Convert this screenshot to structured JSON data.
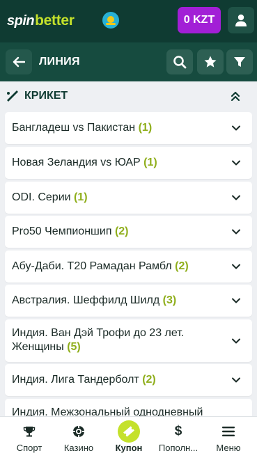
{
  "header": {
    "logo_left": "spin",
    "logo_right": "better",
    "balance": "0 KZT"
  },
  "subheader": {
    "title": "ЛИНИЯ"
  },
  "section": {
    "title": "КРИКЕТ"
  },
  "leagues": [
    {
      "name": "Бангладеш vs Пакистан",
      "count": "(1)"
    },
    {
      "name": "Новая Зеландия vs ЮАР",
      "count": "(1)"
    },
    {
      "name": "ODI. Серии",
      "count": "(1)"
    },
    {
      "name": "Pro50 Чемпионшип",
      "count": "(2)"
    },
    {
      "name": "Абу-Даби. T20 Рамадан Рамбл",
      "count": "(2)"
    },
    {
      "name": "Австралия. Шеффилд Шилд",
      "count": "(3)"
    },
    {
      "name": "Индия. Ван Дэй Трофи до 23 лет. Женщины",
      "count": "(5)"
    },
    {
      "name": "Индия. Лига Тандерболт",
      "count": "(2)"
    },
    {
      "name": "Индия. Межзональный однодневный",
      "count": ""
    }
  ],
  "bottom_nav": [
    {
      "label": "Спорт",
      "icon": "trophy-icon"
    },
    {
      "label": "Казино",
      "icon": "casino-chip-icon"
    },
    {
      "label": "Купон",
      "icon": "coupon-ticket-icon"
    },
    {
      "label": "Пополн...",
      "icon": "dollar-icon"
    },
    {
      "label": "Меню",
      "icon": "hamburger-menu-icon"
    }
  ],
  "colors": {
    "header_bg": "#0f3b32",
    "subheader_bg": "#164b3f",
    "accent_green": "#c4e12b",
    "balance_purple": "#a21fd6",
    "count_green": "#8fae1b"
  }
}
